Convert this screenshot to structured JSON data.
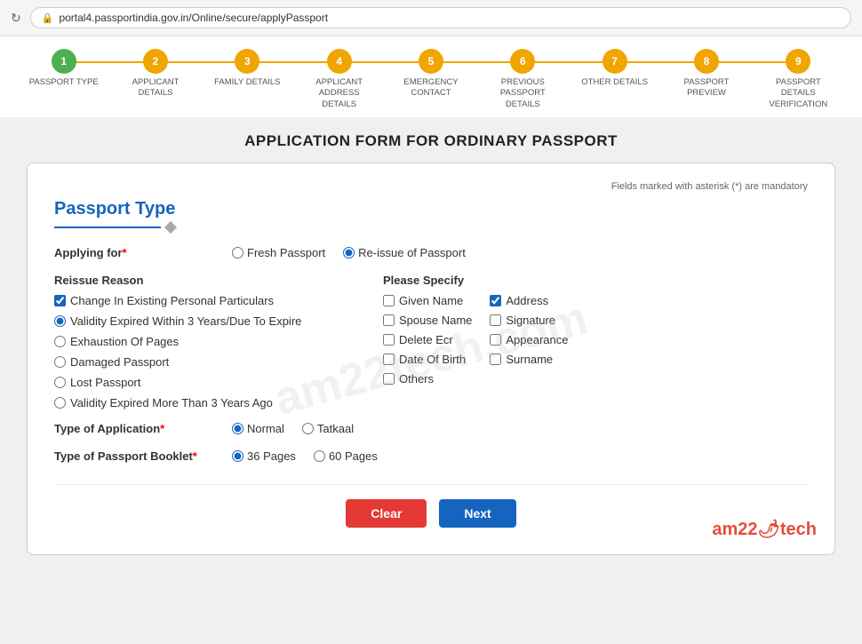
{
  "browser": {
    "url": "portal4.passportindia.gov.in/Online/secure/applyPassport",
    "lock_icon": "🔒"
  },
  "progress": {
    "steps": [
      {
        "number": "1",
        "label": "PASSPORT TYPE",
        "active": true
      },
      {
        "number": "2",
        "label": "APPLICANT DETAILS",
        "active": false
      },
      {
        "number": "3",
        "label": "FAMILY DETAILS",
        "active": false
      },
      {
        "number": "4",
        "label": "APPLICANT ADDRESS DETAILS",
        "active": false
      },
      {
        "number": "5",
        "label": "EMERGENCY CONTACT",
        "active": false
      },
      {
        "number": "6",
        "label": "PREVIOUS PASSPORT DETAILS",
        "active": false
      },
      {
        "number": "7",
        "label": "OTHER DETAILS",
        "active": false
      },
      {
        "number": "8",
        "label": "PASSPORT PREVIEW",
        "active": false
      },
      {
        "number": "9",
        "label": "PASSPORT DETAILS VERIFICATION",
        "active": false
      }
    ]
  },
  "page_title": "APPLICATION FORM FOR ORDINARY PASSPORT",
  "mandatory_note": "Fields marked with asterisk (*) are mandatory",
  "section_title": "Passport Type",
  "applying_for_label": "Applying for",
  "applying_for_options": [
    "Fresh Passport",
    "Re-issue of Passport"
  ],
  "applying_for_selected": "Re-issue of Passport",
  "reissue_reason_label": "Reissue Reason",
  "please_specify_label": "Please Specify",
  "reissue_options": [
    {
      "label": "Change In Existing Personal Particulars",
      "type": "checkbox",
      "checked": true
    },
    {
      "label": "Validity Expired Within 3 Years/Due To Expire",
      "type": "radio",
      "checked": true
    },
    {
      "label": "Exhaustion Of Pages",
      "type": "radio",
      "checked": false
    },
    {
      "label": "Damaged Passport",
      "type": "radio",
      "checked": false
    },
    {
      "label": "Lost Passport",
      "type": "radio",
      "checked": false
    },
    {
      "label": "Validity Expired More Than 3 Years Ago",
      "type": "radio",
      "checked": false
    }
  ],
  "specify_col1": [
    {
      "label": "Given Name",
      "checked": false
    },
    {
      "label": "Spouse Name",
      "checked": false
    },
    {
      "label": "Delete Ecr",
      "checked": false
    },
    {
      "label": "Date Of Birth",
      "checked": false
    },
    {
      "label": "Others",
      "checked": false
    }
  ],
  "specify_col2": [
    {
      "label": "Address",
      "checked": true
    },
    {
      "label": "Signature",
      "checked": false
    },
    {
      "label": "Appearance",
      "checked": false
    },
    {
      "label": "Surname",
      "checked": false
    }
  ],
  "type_of_application_label": "Type of Application",
  "type_of_application_options": [
    "Normal",
    "Tatkaal"
  ],
  "type_of_application_selected": "Normal",
  "passport_booklet_label": "Type of Passport Booklet",
  "passport_booklet_options": [
    "36 Pages",
    "60 Pages"
  ],
  "passport_booklet_selected": "36 Pages",
  "buttons": {
    "clear": "Clear",
    "next": "Next"
  },
  "brand": {
    "text_before": "am22",
    "icon": "🌶",
    "text_after": "tech"
  }
}
